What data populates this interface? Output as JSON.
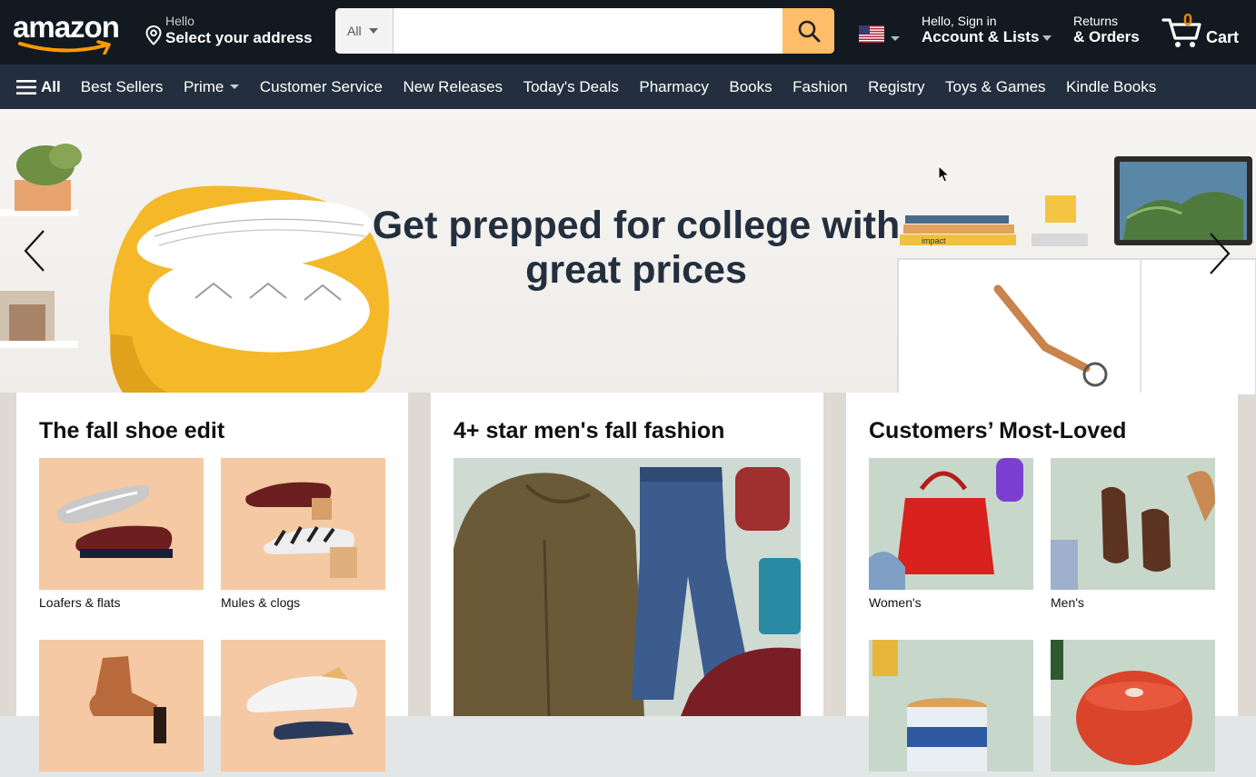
{
  "header": {
    "logo_text": "amazon",
    "address_line1": "Hello",
    "address_line2": "Select your address",
    "search": {
      "category": "All",
      "placeholder": "",
      "value": ""
    },
    "account_line1": "Hello, Sign in",
    "account_line2": "Account & Lists",
    "returns_line1": "Returns",
    "returns_line2": "& Orders",
    "cart_count": "0",
    "cart_label": "Cart",
    "icons": {
      "location": "location-pin-icon",
      "search": "search-icon",
      "flag": "us-flag-icon",
      "cart": "cart-icon"
    },
    "colors": {
      "nav_bg": "#131921",
      "subnav_bg": "#232f3e",
      "search_button": "#febd69",
      "cart_count": "#f08804"
    }
  },
  "subnav": {
    "all_label": "All",
    "items": [
      "Best Sellers",
      "Prime",
      "Customer Service",
      "New Releases",
      "Today's Deals",
      "Pharmacy",
      "Books",
      "Fashion",
      "Registry",
      "Toys & Games",
      "Kindle Books"
    ]
  },
  "hero": {
    "title": "Get prepped for college with great prices",
    "book_label": "impact"
  },
  "cards": [
    {
      "title": "The fall shoe edit",
      "tiles": [
        {
          "label": "Loafers & flats"
        },
        {
          "label": "Mules & clogs"
        },
        {
          "label": ""
        },
        {
          "label": ""
        }
      ]
    },
    {
      "title": "4+ star men's fall fashion"
    },
    {
      "title": "Customers’ Most-Loved",
      "tiles": [
        {
          "label": "Women's"
        },
        {
          "label": "Men's"
        },
        {
          "label": ""
        },
        {
          "label": ""
        }
      ]
    }
  ]
}
